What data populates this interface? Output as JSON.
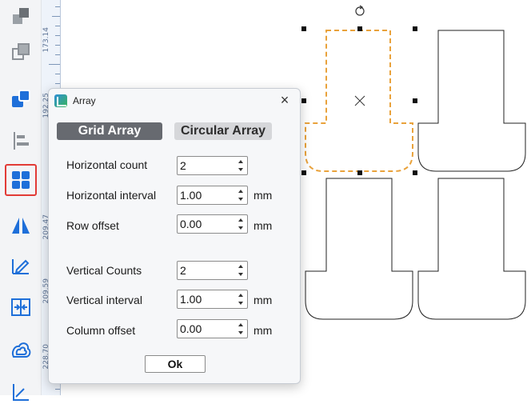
{
  "toolbar": {
    "items": [
      {
        "icon": "layers-stack-icon"
      },
      {
        "icon": "duplicate-icon"
      },
      {
        "icon": "combine-shapes-icon"
      },
      {
        "icon": "align-left-icon"
      },
      {
        "icon": "array-grid-icon",
        "active": true
      },
      {
        "icon": "mirror-flip-icon"
      },
      {
        "icon": "edit-pen-icon"
      },
      {
        "icon": "fit-to-frame-icon"
      },
      {
        "icon": "offset-outline-icon"
      },
      {
        "icon": "measure-icon"
      }
    ]
  },
  "ruler": {
    "labels": [
      "173.14",
      "192.25",
      "209.47",
      "209.59",
      "228.70"
    ]
  },
  "dialog": {
    "title": "Array",
    "close_label": "×",
    "tabs": {
      "grid": "Grid Array",
      "circular": "Circular Array",
      "active": "grid"
    },
    "fields": {
      "horizontal_count": {
        "label": "Horizontal count",
        "value": "2"
      },
      "horizontal_interval": {
        "label": "Horizontal interval",
        "value": "1.00",
        "unit": "mm"
      },
      "row_offset": {
        "label": "Row offset",
        "value": "0.00",
        "unit": "mm"
      },
      "vertical_counts": {
        "label": "Vertical Counts",
        "value": "2"
      },
      "vertical_interval": {
        "label": "Vertical interval",
        "value": "1.00",
        "unit": "mm"
      },
      "column_offset": {
        "label": "Column offset",
        "value": "0.00",
        "unit": "mm"
      }
    },
    "ok_label": "Ok"
  },
  "colors": {
    "selection_outline": "#e9a23b",
    "active_tool_border": "#e23b36",
    "tool_blue": "#1e6fd9",
    "tab_active_bg": "#676a70",
    "tab_inactive_bg": "#d6d7da"
  }
}
